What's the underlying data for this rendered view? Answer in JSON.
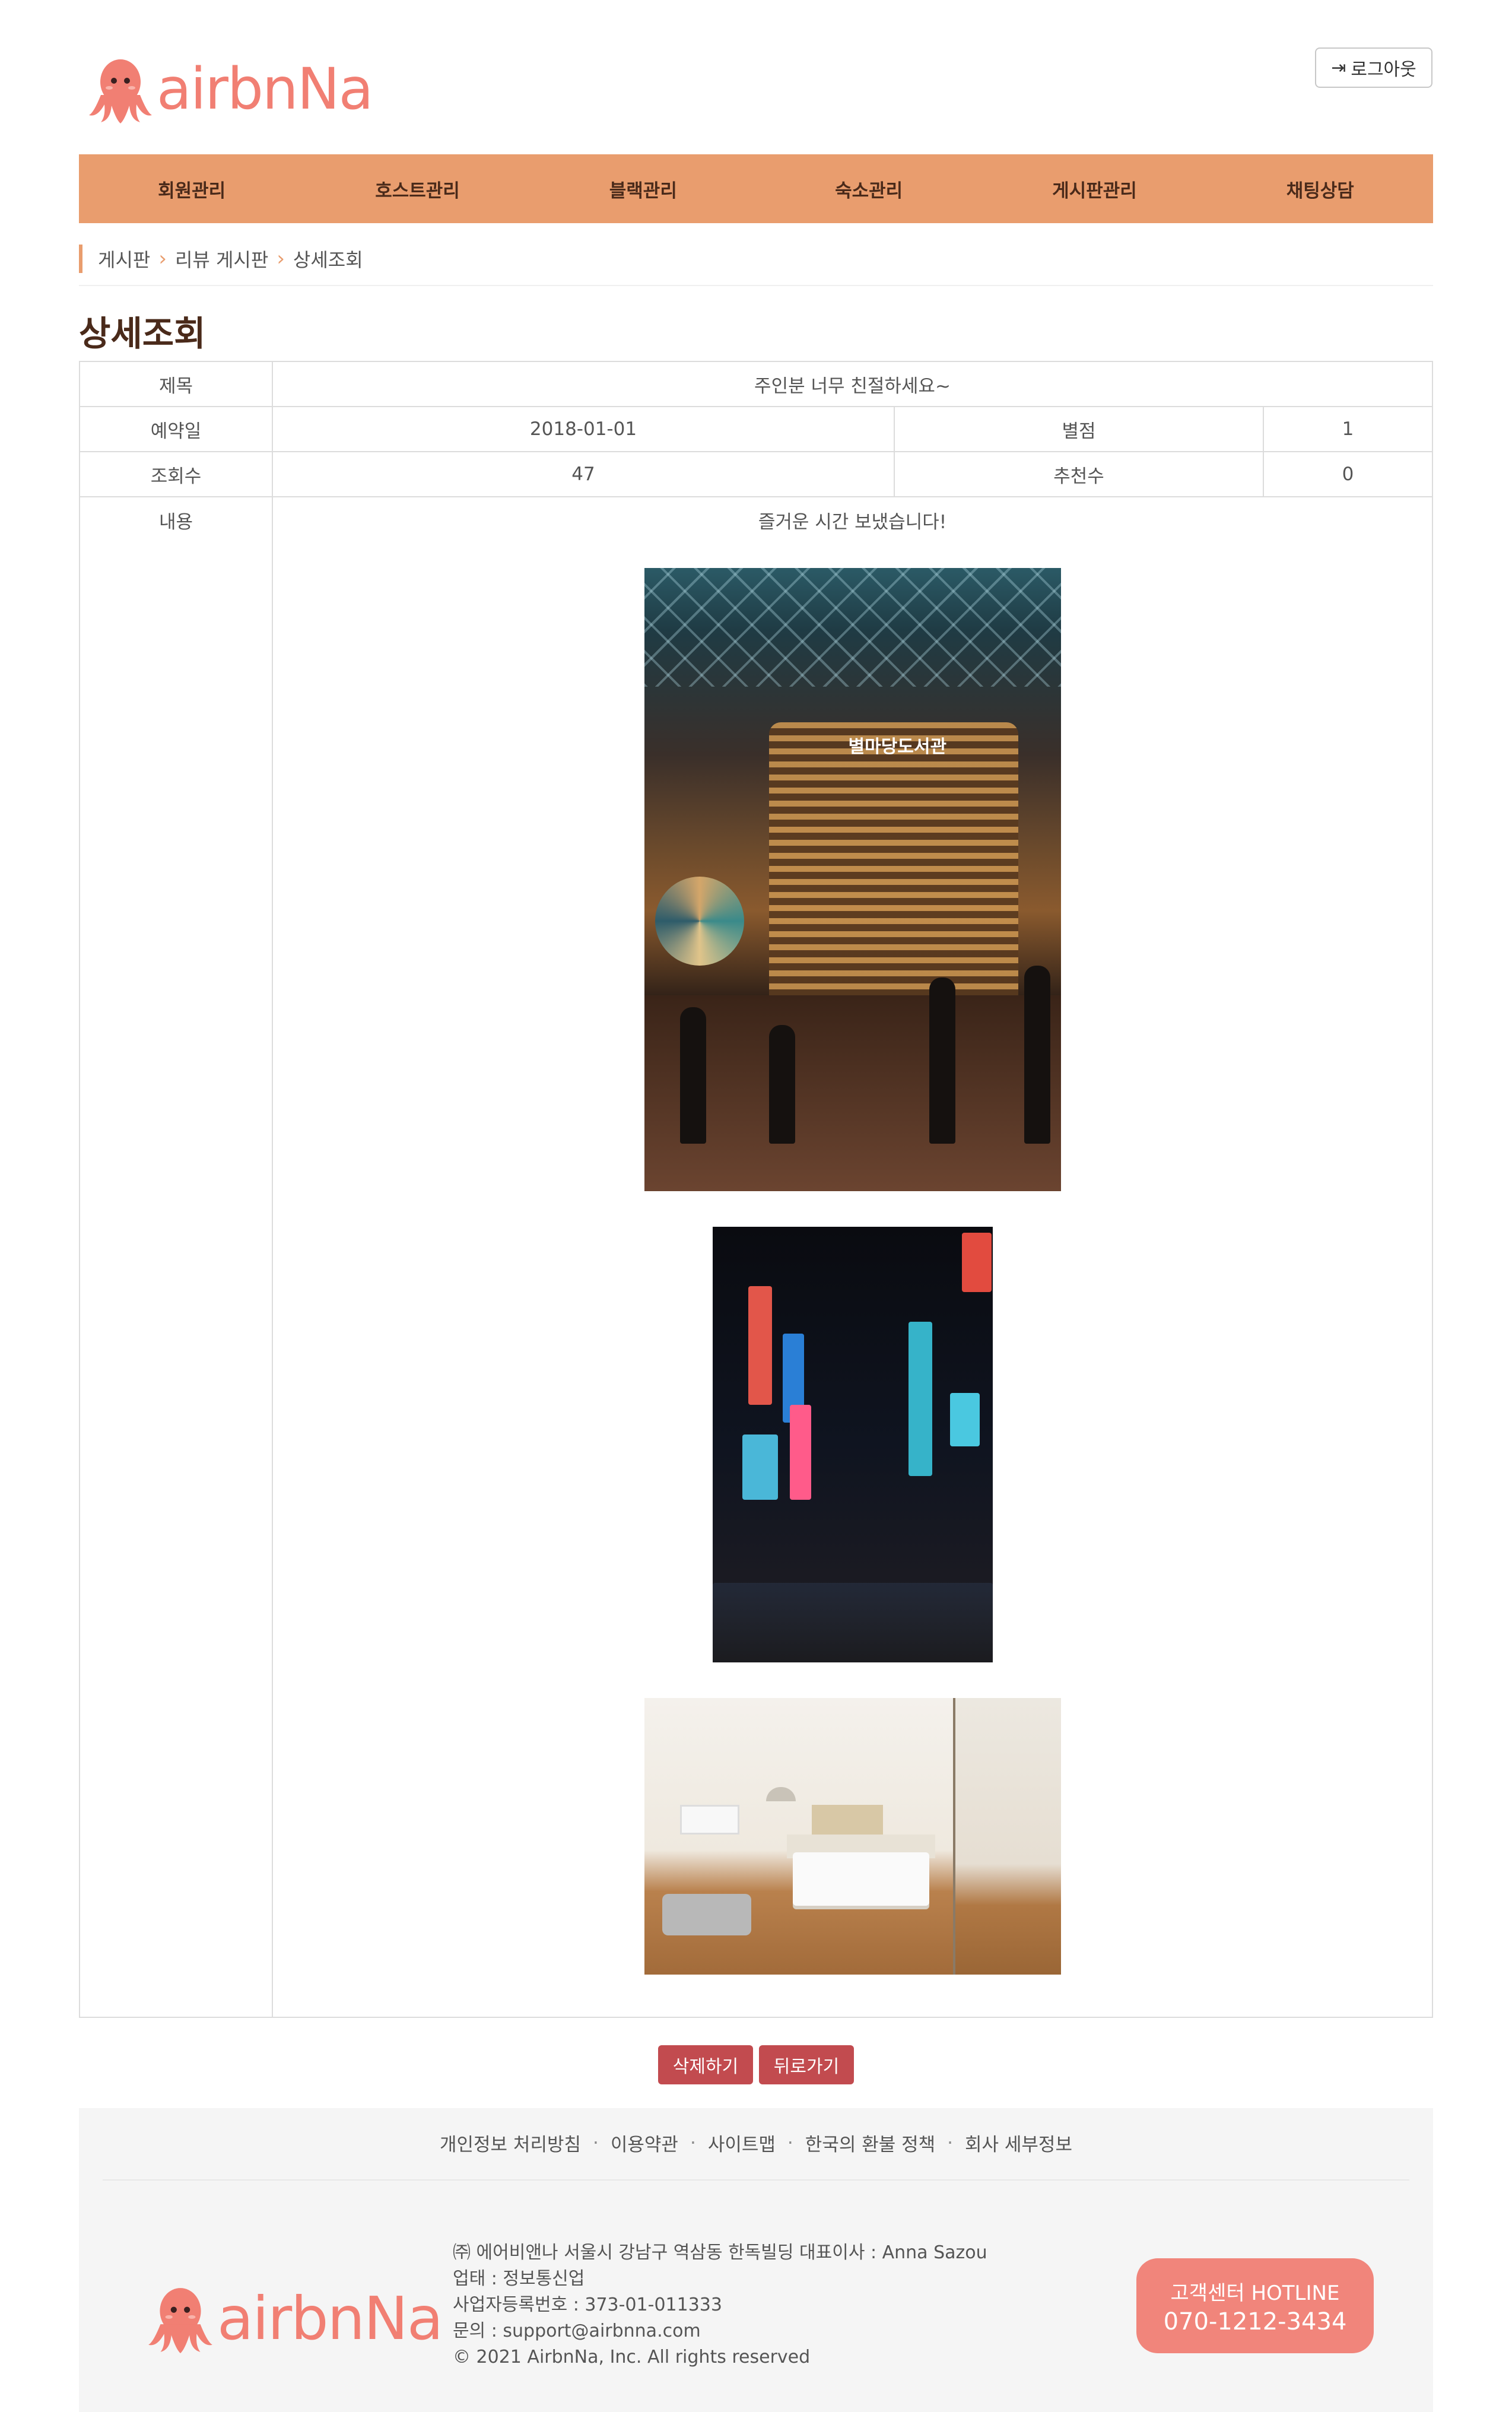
{
  "brand": {
    "name": "airbnNa",
    "color": "#f17f73"
  },
  "header": {
    "logout_label": "로그아웃",
    "logout_icon": "sign-out-icon"
  },
  "nav": {
    "color": "#e99d6e",
    "items": [
      "회원관리",
      "호스트관리",
      "블랙관리",
      "숙소관리",
      "게시판관리",
      "채팅상담"
    ]
  },
  "breadcrumb": [
    "게시판",
    "리뷰 게시판",
    "상세조회"
  ],
  "page_title": "상세조회",
  "detail": {
    "title_label": "제목",
    "title_value": "주인분 너무 친절하세요~",
    "date_label": "예약일",
    "date_value": "2018-01-01",
    "rating_label": "별점",
    "rating_value": "1",
    "views_label": "조회수",
    "views_value": "47",
    "likes_label": "추천수",
    "likes_value": "0",
    "content_label": "내용",
    "content_text": "즐거운 시간 보냈습니다!",
    "image1_sign": "별마당도서관"
  },
  "actions": {
    "delete_label": "삭제하기",
    "back_label": "뒤로가기",
    "color": "#c24b4f"
  },
  "footer": {
    "links": [
      "개인정보 처리방침",
      "이용약관",
      "사이트맵",
      "한국의 환불 정책",
      "회사 세부정보"
    ],
    "company_lines": [
      "㈜ 에어비앤나    서울시 강남구 역삼동 한독빌딩    대표이사 : Anna Sazou",
      "업태 : 정보통신업",
      "사업자등록번호 : 373-01-011333",
      "문의 : support@airbnna.com",
      "© 2021 AirbnNa, Inc. All rights reserved"
    ],
    "hotline_label": "고객센터 HOTLINE",
    "hotline_number": "070-1212-3434",
    "hotline_color": "#f1857b"
  }
}
